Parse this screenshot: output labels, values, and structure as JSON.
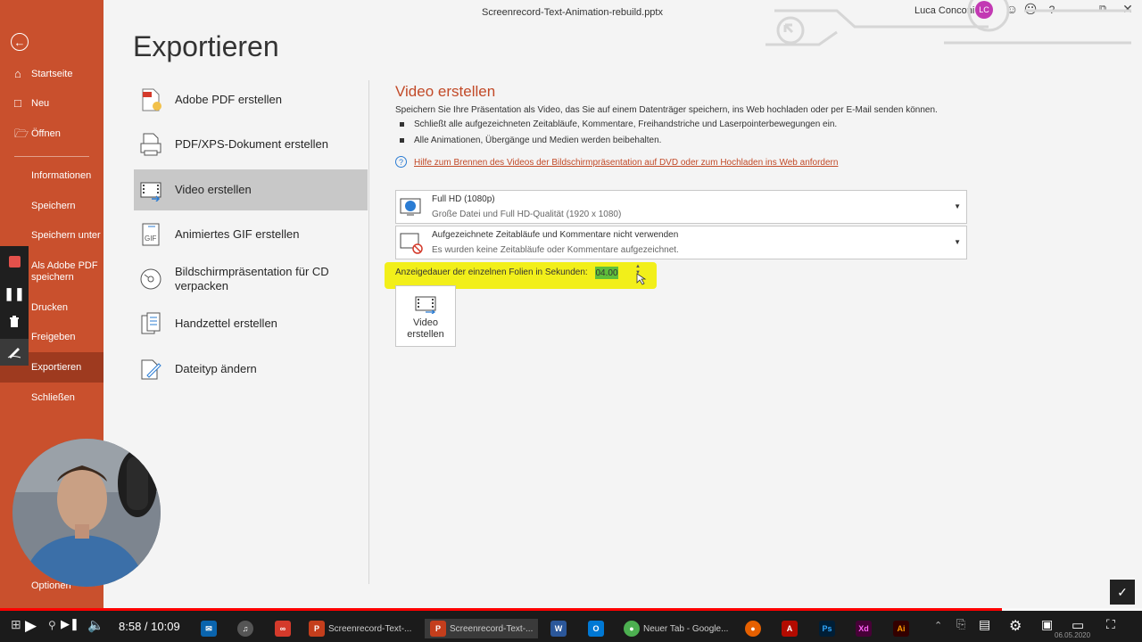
{
  "window": {
    "doc_title": "Screenrecord-Text-Animation-rebuild.pptx",
    "user_name": "Luca Conconi",
    "user_initials": "LC"
  },
  "sidebar": {
    "items": [
      {
        "label": "Startseite",
        "icon": "home-icon"
      },
      {
        "label": "Neu",
        "icon": "new-doc-icon"
      },
      {
        "label": "Öffnen",
        "icon": "folder-icon"
      },
      {
        "label": "Informationen"
      },
      {
        "label": "Speichern"
      },
      {
        "label": "Speichern unter"
      },
      {
        "label": "Als Adobe PDF speichern"
      },
      {
        "label": "Drucken"
      },
      {
        "label": "Freigeben"
      },
      {
        "label": "Exportieren"
      },
      {
        "label": "Schließen"
      },
      {
        "label": "Optionen"
      }
    ],
    "active": "Exportieren"
  },
  "page_heading": "Exportieren",
  "export_options": [
    {
      "label": "Adobe PDF erstellen",
      "icon": "adobe-pdf-icon"
    },
    {
      "label": "PDF/XPS-Dokument erstellen",
      "icon": "pdf-xps-icon"
    },
    {
      "label": "Video erstellen",
      "icon": "video-icon",
      "selected": true
    },
    {
      "label": "Animiertes GIF erstellen",
      "icon": "gif-icon"
    },
    {
      "label": "Bildschirmpräsentation für CD verpacken",
      "icon": "cd-icon"
    },
    {
      "label": "Handzettel erstellen",
      "icon": "handout-icon"
    },
    {
      "label": "Dateityp ändern",
      "icon": "change-filetype-icon"
    }
  ],
  "video_panel": {
    "title": "Video erstellen",
    "description": "Speichern Sie Ihre Präsentation als Video, das Sie auf einem Datenträger speichern, ins Web hochladen oder per E-Mail senden können.",
    "bullets": [
      "Schließt alle aufgezeichneten Zeitabläufe, Kommentare, Freihandstriche und Laserpointerbewegungen ein.",
      "Alle Animationen, Übergänge und Medien werden beibehalten."
    ],
    "help_link": "Hilfe zum Brennen des Videos der Bildschirmpräsentation auf DVD oder zum Hochladen ins Web anfordern",
    "quality_dropdown": {
      "main": "Full HD (1080p)",
      "sub": "Große Datei und Full HD-Qualität (1920 x 1080)"
    },
    "timing_dropdown": {
      "main": "Aufgezeichnete Zeitabläufe und Kommentare nicht verwenden",
      "sub": "Es wurden keine Zeitabläufe oder Kommentare aufgezeichnet."
    },
    "duration_label": "Anzeigedauer der einzelnen Folien in Sekunden:",
    "duration_value": "04.00",
    "create_button": "Video erstellen"
  },
  "player": {
    "time": "8:58 / 10:09",
    "progress": 0.877,
    "progress_color": "#ff0000"
  },
  "taskbar": {
    "apps": [
      {
        "label": "Screenrecord-Text-...",
        "icon": "powerpoint-icon",
        "color": "#c43e1c"
      },
      {
        "label": "Screenrecord-Text-...",
        "icon": "powerpoint-icon",
        "color": "#c43e1c",
        "active": true
      },
      {
        "label": "Neuer Tab - Google...",
        "icon": "chrome-icon",
        "color": "#4caf50"
      }
    ],
    "date": "06.05.2020"
  },
  "colors": {
    "sidebar": "#c9502d",
    "accent": "#c24a28",
    "highlight": "#f2ef1a"
  }
}
